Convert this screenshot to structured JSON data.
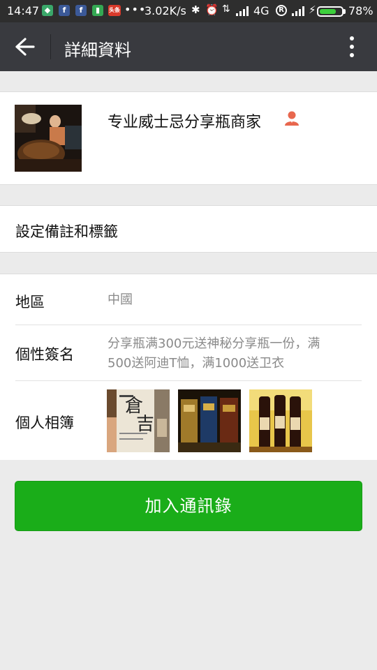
{
  "status_bar": {
    "time": "14:47",
    "notification_icons": [
      "shield-icon",
      "facebook-icon",
      "facebook-icon",
      "battery-app-icon",
      "toutiao-news-icon"
    ],
    "news_icon_label": "头条",
    "overflow": "•••",
    "net_speed": "3.02K/s",
    "network_type": "4G",
    "battery_percent": "78%",
    "battery_level": 0.78,
    "colors": {
      "background": "#2e2e2e",
      "battery_fill": "#3ccf3c"
    }
  },
  "title_bar": {
    "title": "詳細資料",
    "back_icon": "arrow-left-icon",
    "more_icon": "more-vertical-icon",
    "background": "#393a3f"
  },
  "profile": {
    "name": "专业威士忌分享瓶商家",
    "badge_icon": "person-icon",
    "badge_color": "#e8674e"
  },
  "remark": {
    "label": "設定備註和標籤"
  },
  "info": {
    "region_label": "地區",
    "region_value": "中國",
    "signature_label": "個性簽名",
    "signature_line1": "分享瓶满300元送神秘分享瓶一份，满",
    "signature_line2": "500送阿迪T恤，满1000送卫衣",
    "album_label": "個人相簿",
    "album_photos": [
      "whisky-bottle-label-photo",
      "whisky-boxes-photo",
      "whisky-bottles-photo"
    ]
  },
  "action": {
    "add_contact_label": "加入通訊錄",
    "color": "#1aad19"
  }
}
